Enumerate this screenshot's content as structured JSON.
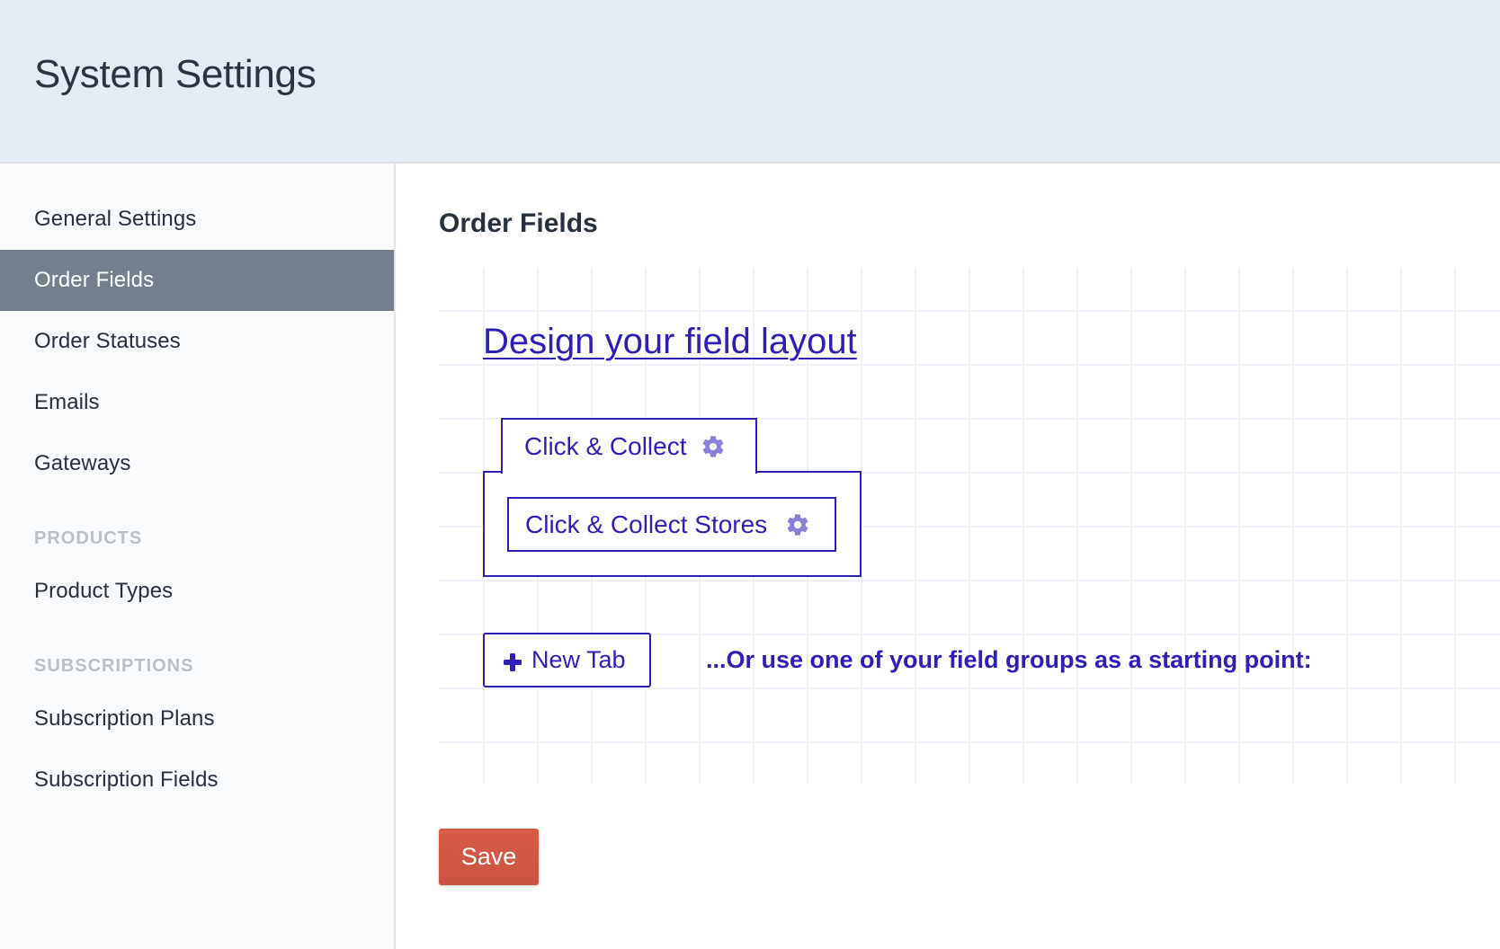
{
  "header": {
    "title": "System Settings"
  },
  "sidebar": {
    "items": [
      {
        "label": "General Settings",
        "active": false
      },
      {
        "label": "Order Fields",
        "active": true
      },
      {
        "label": "Order Statuses",
        "active": false
      },
      {
        "label": "Emails",
        "active": false
      },
      {
        "label": "Gateways",
        "active": false
      }
    ],
    "sections": [
      {
        "heading": "PRODUCTS",
        "items": [
          {
            "label": "Product Types"
          }
        ]
      },
      {
        "heading": "SUBSCRIPTIONS",
        "items": [
          {
            "label": "Subscription Plans"
          },
          {
            "label": "Subscription Fields"
          }
        ]
      }
    ]
  },
  "main": {
    "title": "Order Fields",
    "designer": {
      "heading_link": "Design your field layout",
      "tabs": [
        {
          "label": "Click & Collect",
          "icon": "gear-icon",
          "fields": [
            {
              "label": "Click & Collect Stores",
              "icon": "gear-icon"
            }
          ]
        }
      ],
      "new_tab_label": "New Tab",
      "new_tab_icon": "plus-icon",
      "field_groups_prompt": "...Or use one of your field groups as a starting point:"
    },
    "save_label": "Save"
  },
  "colors": {
    "accent": "#2e1fb8",
    "gear": "#8a80d8",
    "save": "#d45846",
    "sidebar_active": "#737f8d",
    "header_bg": "#e5ecf4"
  }
}
